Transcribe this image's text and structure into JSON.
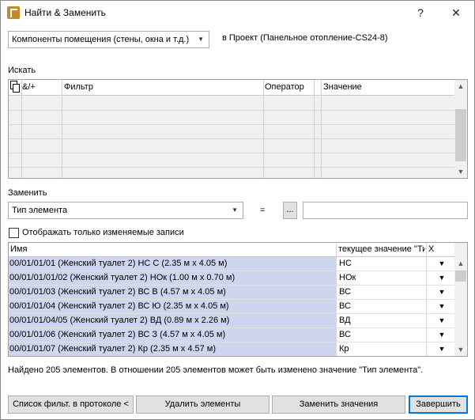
{
  "window": {
    "title": "Найти & Заменить",
    "help_label": "?",
    "close_label": "✕"
  },
  "scope": {
    "selected": "Компоненты помещения (стены, окна и т.д.)",
    "context_text": "в Проект (Панельное отопление-CS24-8)"
  },
  "search": {
    "section_label": "Искать",
    "columns": [
      "&/+",
      "Фильтр",
      "Оператор",
      "Значение"
    ]
  },
  "replace": {
    "section_label": "Заменить",
    "field_selected": "Тип элемента",
    "equals_label": "=",
    "browse_label": "...",
    "value": ""
  },
  "show_changed_only": {
    "label": "Отображать только изменяемые записи",
    "checked": false
  },
  "results": {
    "columns": [
      "Имя",
      "текущее значение \"Тип",
      "X"
    ],
    "rows": [
      {
        "name": "00/01/01/01 (Женский туалет 2) НС С (2.35 м x 4.05 м)",
        "value": "НС"
      },
      {
        "name": "00/01/01/01/02 (Женский туалет 2) НОк (1.00 м x 0.70 м)",
        "value": "НОк"
      },
      {
        "name": "00/01/01/03 (Женский туалет 2) ВС В (4.57 м x 4.05 м)",
        "value": "ВС"
      },
      {
        "name": "00/01/01/04 (Женский туалет 2) ВС Ю (2.35 м x 4.05 м)",
        "value": "ВС"
      },
      {
        "name": "00/01/01/04/05 (Женский туалет 2) ВД (0.89 м x 2.26 м)",
        "value": "ВД"
      },
      {
        "name": "00/01/01/06 (Женский туалет 2) ВС З (4.57 м x 4.05 м)",
        "value": "ВС"
      },
      {
        "name": "00/01/01/07 (Женский туалет 2) Кр (2.35 м x 4.57 м)",
        "value": "Кр"
      }
    ]
  },
  "status_text": "Найдено 205 элементов. В отношении 205 элементов может быть изменено значение \"Тип элемента\".",
  "buttons": {
    "filter_log": "Список фильт. в протоколе <",
    "delete": "Удалить элементы",
    "replace": "Заменить значения",
    "finish": "Завершить"
  },
  "icons": {
    "dropdown": "chevron-down-icon",
    "scroll_up": "scroll-up-icon",
    "scroll_down": "scroll-down-icon",
    "copy": "copy-icon"
  }
}
